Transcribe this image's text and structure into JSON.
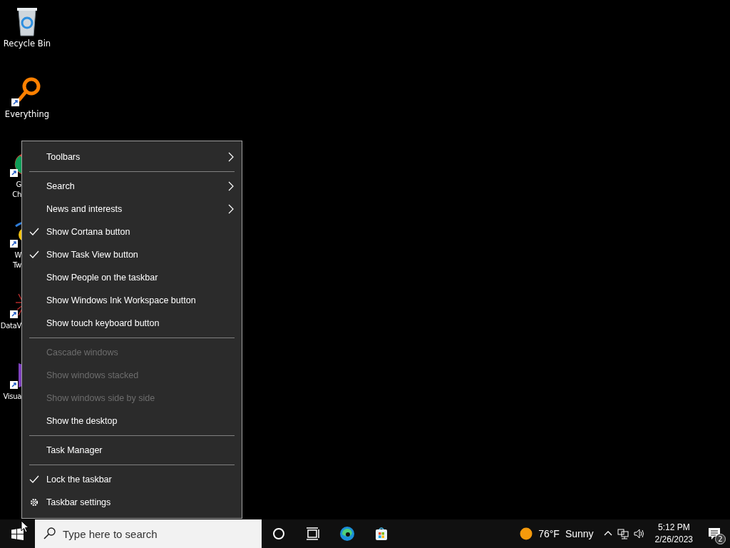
{
  "desktop_icons": [
    {
      "kind": "recycle",
      "lines": [
        "Recycle Bin"
      ],
      "covered": false
    },
    {
      "kind": "magnifier",
      "lines": [
        "Everything"
      ],
      "covered": false
    },
    {
      "kind": "chrome",
      "lines": [
        "G",
        "Ch"
      ],
      "covered": true
    },
    {
      "kind": "bird",
      "lines": [
        "W",
        "Tw"
      ],
      "covered": true
    },
    {
      "kind": "star",
      "lines": [
        "DataV"
      ],
      "covered": true
    },
    {
      "kind": "studio",
      "lines": [
        "Visua"
      ],
      "covered": true
    }
  ],
  "context_menu": {
    "items": [
      {
        "kind": "submenu",
        "label": "Toolbars",
        "checked": false,
        "disabled": false
      },
      {
        "kind": "separator"
      },
      {
        "kind": "submenu",
        "label": "Search",
        "checked": false,
        "disabled": false
      },
      {
        "kind": "submenu",
        "label": "News and interests",
        "checked": false,
        "disabled": false
      },
      {
        "kind": "item",
        "label": "Show Cortana button",
        "checked": true,
        "disabled": false
      },
      {
        "kind": "item",
        "label": "Show Task View button",
        "checked": true,
        "disabled": false
      },
      {
        "kind": "item",
        "label": "Show People on the taskbar",
        "checked": false,
        "disabled": false
      },
      {
        "kind": "item",
        "label": "Show Windows Ink Workspace button",
        "checked": false,
        "disabled": false
      },
      {
        "kind": "item",
        "label": "Show touch keyboard button",
        "checked": false,
        "disabled": false
      },
      {
        "kind": "separator"
      },
      {
        "kind": "item",
        "label": "Cascade windows",
        "checked": false,
        "disabled": true
      },
      {
        "kind": "item",
        "label": "Show windows stacked",
        "checked": false,
        "disabled": true
      },
      {
        "kind": "item",
        "label": "Show windows side by side",
        "checked": false,
        "disabled": true
      },
      {
        "kind": "item",
        "label": "Show the desktop",
        "checked": false,
        "disabled": false
      },
      {
        "kind": "separator"
      },
      {
        "kind": "item",
        "label": "Task Manager",
        "checked": false,
        "disabled": false
      },
      {
        "kind": "separator"
      },
      {
        "kind": "item",
        "label": "Lock the taskbar",
        "checked": true,
        "disabled": false
      },
      {
        "kind": "settings",
        "label": "Taskbar settings",
        "checked": false,
        "disabled": false
      }
    ]
  },
  "taskbar": {
    "search": {
      "placeholder": "Type here to search"
    },
    "weather": {
      "temperature": "76°F",
      "condition": "Sunny"
    },
    "clock": {
      "time": "5:12 PM",
      "date": "2/26/2023"
    },
    "notifications": {
      "count": "2"
    }
  }
}
